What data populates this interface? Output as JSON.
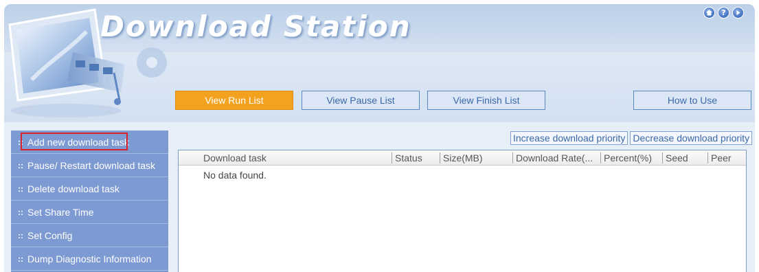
{
  "header": {
    "title": "Download Station",
    "top_icons": [
      "home-icon",
      "help-icon",
      "next-icon"
    ]
  },
  "nav": {
    "view_run_list": "View Run List",
    "view_pause_list": "View Pause List",
    "view_finish_list": "View Finish List",
    "how_to_use": "How to Use",
    "active": "View Run List"
  },
  "sidebar": {
    "items": [
      {
        "label": "Add new download task"
      },
      {
        "label": "Pause/ Restart download task"
      },
      {
        "label": "Delete download task"
      },
      {
        "label": "Set Share Time"
      },
      {
        "label": "Set Config"
      },
      {
        "label": "Dump Diagnostic Information"
      }
    ],
    "highlighted": "Add new download task"
  },
  "priority": {
    "increase": "Increase download priority",
    "decrease": "Decrease download priority"
  },
  "table": {
    "columns": [
      "Download task",
      "Status",
      "Size(MB)",
      "Download Rate(...",
      "Percent(%)",
      "Seed",
      "Peer"
    ],
    "empty_message": "No data found."
  },
  "colors": {
    "active_tab": "#f3a21f",
    "sidebar": "#7e9ad3",
    "highlight_box": "#d8232a",
    "link_blue": "#3a67a8"
  }
}
